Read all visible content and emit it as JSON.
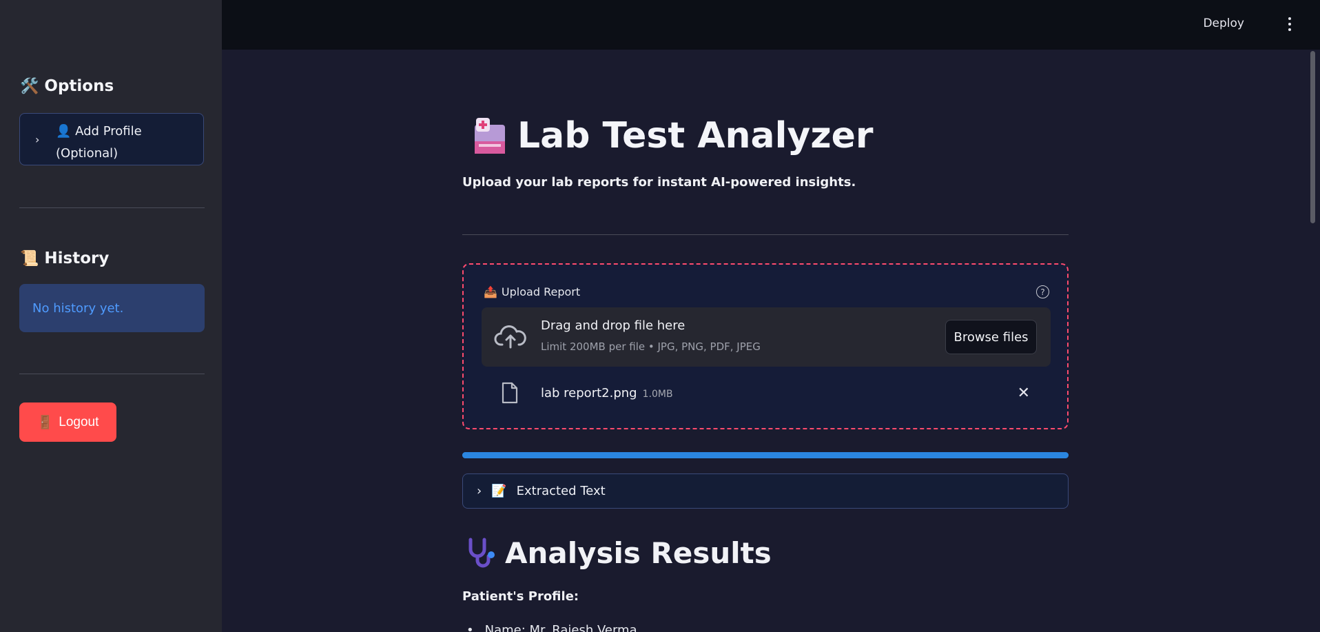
{
  "sidebar": {
    "options_title": "Options",
    "options_emoji": "🛠️",
    "add_profile_label_line1": "👤 Add Profile",
    "add_profile_label_line2": "(Optional)",
    "history_title": "History",
    "history_emoji": "📜",
    "history_empty": "No history yet.",
    "logout_label": "Logout",
    "logout_emoji": "🚪"
  },
  "header": {
    "deploy_label": "Deploy"
  },
  "main": {
    "title": "Lab Test Analyzer",
    "title_emoji": "🏥",
    "subtitle": "Upload your lab reports for instant AI-powered insights.",
    "upload": {
      "label": "Upload Report",
      "label_emoji": "📤",
      "help": "?",
      "drop_title": "Drag and drop file here",
      "drop_limit": "Limit 200MB per file • JPG, PNG, PDF, JPEG",
      "browse_label": "Browse files",
      "file_name": "lab report2.png",
      "file_size": "1.0MB"
    },
    "progress_fraction": 1.0,
    "extracted_text_label": "Extracted Text",
    "extracted_text_emoji": "📝",
    "analysis_title": "Analysis Results",
    "analysis_emoji": "🩺",
    "patient_profile_label": "Patient's Profile:",
    "first_bullet": "Name: Mr. Rajesh Verma"
  },
  "colors": {
    "sidebar_bg": "#262730",
    "main_bg": "#1a1b2e",
    "accent_red": "#ff4b4b",
    "progress_blue": "#2b86e0",
    "info_text": "#4f9bff"
  }
}
